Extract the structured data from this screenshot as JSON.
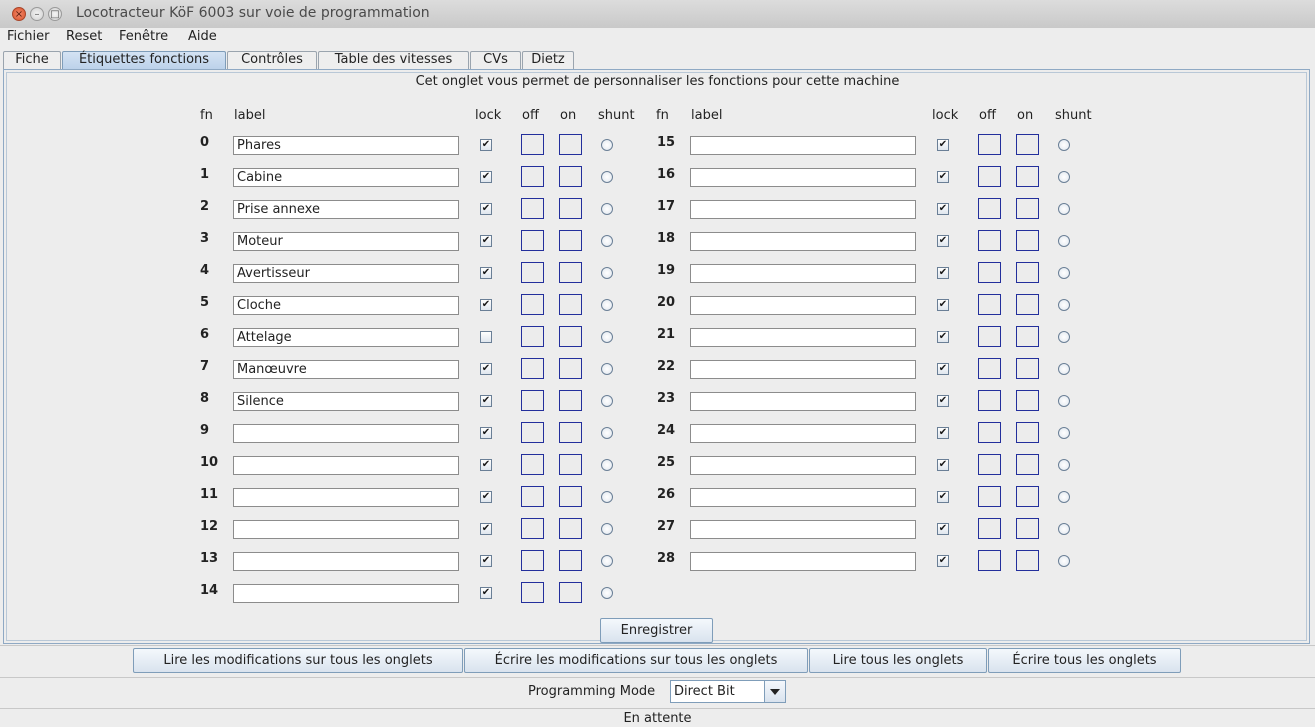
{
  "window": {
    "title": "Locotracteur KöF 6003 sur voie de programmation"
  },
  "menu": [
    "Fichier",
    "Reset",
    "Fenêtre",
    "Aide"
  ],
  "tabs": [
    {
      "label": "Fiche",
      "selected": false
    },
    {
      "label": "Étiquettes fonctions",
      "selected": true
    },
    {
      "label": "Contrôles",
      "selected": false
    },
    {
      "label": "Table des vitesses",
      "selected": false
    },
    {
      "label": "CVs",
      "selected": false
    },
    {
      "label": "Dietz",
      "selected": false
    }
  ],
  "panel": {
    "description": "Cet onglet vous permet de personnaliser les fonctions pour cette machine",
    "headers": {
      "fn": "fn",
      "label": "label",
      "lock": "lock",
      "off": "off",
      "on": "on",
      "shunt": "shunt"
    },
    "functions": [
      {
        "fn": "0",
        "label": "Phares",
        "lock": true
      },
      {
        "fn": "1",
        "label": "Cabine",
        "lock": true
      },
      {
        "fn": "2",
        "label": "Prise annexe",
        "lock": true
      },
      {
        "fn": "3",
        "label": "Moteur",
        "lock": true
      },
      {
        "fn": "4",
        "label": "Avertisseur",
        "lock": true
      },
      {
        "fn": "5",
        "label": "Cloche",
        "lock": true
      },
      {
        "fn": "6",
        "label": "Attelage",
        "lock": false
      },
      {
        "fn": "7",
        "label": "Manœuvre",
        "lock": true
      },
      {
        "fn": "8",
        "label": "Silence",
        "lock": true
      },
      {
        "fn": "9",
        "label": "",
        "lock": true
      },
      {
        "fn": "10",
        "label": "",
        "lock": true
      },
      {
        "fn": "11",
        "label": "",
        "lock": true
      },
      {
        "fn": "12",
        "label": "",
        "lock": true
      },
      {
        "fn": "13",
        "label": "",
        "lock": true
      },
      {
        "fn": "14",
        "label": "",
        "lock": true
      },
      {
        "fn": "15",
        "label": "",
        "lock": true
      },
      {
        "fn": "16",
        "label": "",
        "lock": true
      },
      {
        "fn": "17",
        "label": "",
        "lock": true
      },
      {
        "fn": "18",
        "label": "",
        "lock": true
      },
      {
        "fn": "19",
        "label": "",
        "lock": true
      },
      {
        "fn": "20",
        "label": "",
        "lock": true
      },
      {
        "fn": "21",
        "label": "",
        "lock": true
      },
      {
        "fn": "22",
        "label": "",
        "lock": true
      },
      {
        "fn": "23",
        "label": "",
        "lock": true
      },
      {
        "fn": "24",
        "label": "",
        "lock": true
      },
      {
        "fn": "25",
        "label": "",
        "lock": true
      },
      {
        "fn": "26",
        "label": "",
        "lock": true
      },
      {
        "fn": "27",
        "label": "",
        "lock": true
      },
      {
        "fn": "28",
        "label": "",
        "lock": true
      }
    ],
    "save_button": "Enregistrer"
  },
  "bottom_buttons": {
    "read_changes": "Lire les modifications sur tous les onglets",
    "write_changes": "Écrire les modifications sur tous les onglets",
    "read_all": "Lire tous les onglets",
    "write_all": "Écrire tous les onglets"
  },
  "programming_mode": {
    "label": "Programming Mode",
    "value": "Direct Bit"
  },
  "status": "En attente",
  "colors": {
    "tab_selected": "#bcd2ea",
    "icon_box_border": "#232f9c",
    "panel_border": "#8fa9c4"
  }
}
